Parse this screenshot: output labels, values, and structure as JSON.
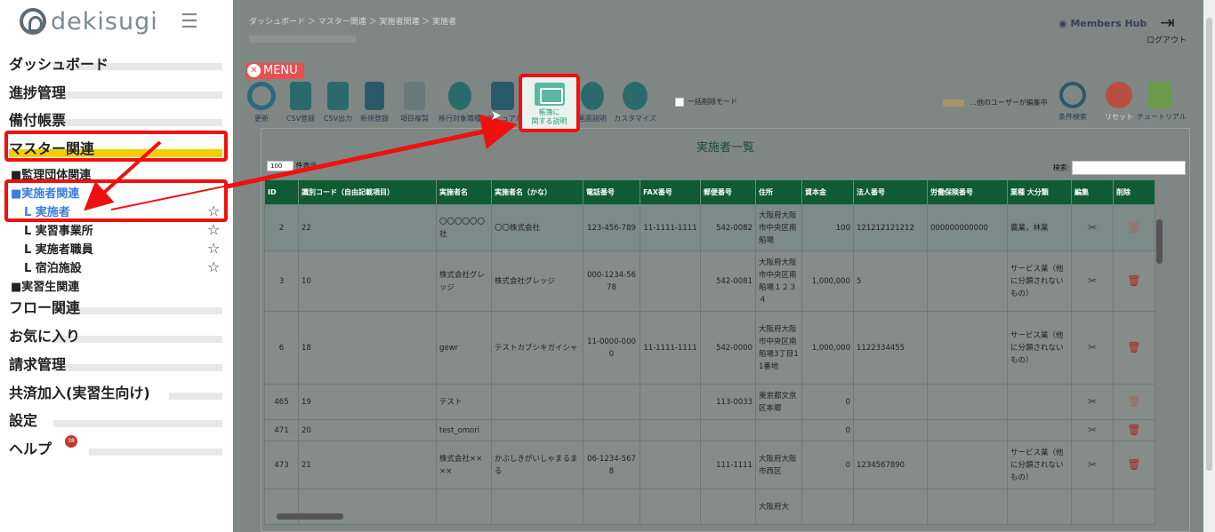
{
  "brand": {
    "name": "dekisugi"
  },
  "sidebar": {
    "sections": [
      {
        "label": "ダッシュボード"
      },
      {
        "label": "進捗管理"
      },
      {
        "label": "備付帳票"
      },
      {
        "label": "マスター関連"
      },
      {
        "label": "フロー関連"
      },
      {
        "label": "お気に入り"
      },
      {
        "label": "請求管理"
      },
      {
        "label": "共済加入(実習生向け)"
      },
      {
        "label": "設定"
      },
      {
        "label": "ヘルプ"
      }
    ],
    "subs": [
      {
        "label": "■監理団体関連"
      },
      {
        "label": "■実施者関連"
      },
      {
        "label": "■実習生関連"
      }
    ],
    "leaves": [
      {
        "label": "L 実施者"
      },
      {
        "label": "L 実習事業所"
      },
      {
        "label": "L 実施者職員"
      },
      {
        "label": "L 宿泊施設"
      }
    ],
    "help_badge": "38"
  },
  "header": {
    "breadcrumb": "ダッシュボード ＞ マスター関連 ＞ 実施者関連 ＞ 実施者",
    "members_hub": "Members Hub",
    "logout": "ログアウト"
  },
  "toolbar": {
    "menu": "MENU",
    "tools": [
      {
        "label": "更新",
        "icon": "refresh-icon"
      },
      {
        "label": "CSV登録",
        "icon": "csv-import-icon"
      },
      {
        "label": "CSV出力",
        "icon": "csv-export-icon"
      },
      {
        "label": "新規登録",
        "icon": "new-record-icon"
      },
      {
        "label": "項目複製",
        "icon": "duplicate-icon"
      },
      {
        "label": "移行対象職種",
        "icon": "transfer-icon"
      },
      {
        "label": "マニュアル",
        "icon": "manual-icon"
      },
      {
        "label": "画面説明",
        "icon": "screen-help-icon"
      },
      {
        "label": "カスタマイズ",
        "icon": "gear-icon"
      }
    ],
    "bulk_delete": "一括削除モード",
    "editing_notice": "…他のユーザーが編集中",
    "search_cond": "条件検索",
    "reset": "リセット",
    "tutorial": "チュートリアル",
    "popup_label_1": "帳簿に",
    "popup_label_2": "関する説明"
  },
  "panel": {
    "title": "実施者一覧",
    "length_value": "100",
    "length_label": "件表示",
    "search_label": "検索:",
    "columns": [
      "ID",
      "識別コード（自由記載項目）",
      "実施者名",
      "実施者名（かな）",
      "電話番号",
      "FAX番号",
      "郵便番号",
      "住所",
      "資本金",
      "法人番号",
      "労働保険番号",
      "業種 大分類",
      "編集",
      "削除"
    ],
    "rows": [
      [
        "2",
        "22",
        "〇〇〇〇〇〇社",
        "〇〇株式会社",
        "123-456-789",
        "11-1111-1111",
        "542-0082",
        "大阪府大阪市中央区南船場",
        "100",
        "121212121212",
        "000000000000",
        "農業，林業"
      ],
      [
        "3",
        "10",
        "株式会社グレッジ",
        "株式会社グレッジ",
        "000-1234-5678",
        "",
        "542-0081",
        "大阪府大阪市中央区南船場１２３４",
        "1,000,000",
        "5",
        "",
        "サービス業（他に分類されないもの）"
      ],
      [
        "6",
        "18",
        "gewr",
        "テストカブシキガイシャ",
        "11-0000-0000",
        "11-1111-1111",
        "542-0000",
        "大阪府大阪市中央区南船場3丁目11番地",
        "1,000,000",
        "1122334455",
        "",
        "サービス業（他に分類されないもの）"
      ],
      [
        "465",
        "19",
        "テスト",
        "",
        "",
        "",
        "113-0033",
        "東京都文京区本郷",
        "0",
        "",
        "",
        ""
      ],
      [
        "471",
        "20",
        "test_omori",
        "",
        "",
        "",
        "",
        "",
        "0",
        "",
        "",
        ""
      ],
      [
        "473",
        "21",
        "株式会社××××",
        "かぶしきがいしゃまるまる",
        "06-1234-5678",
        "",
        "111-1111",
        "大阪府大阪市西区",
        "0",
        "1234567890",
        "",
        "サービス業（他に分類されないもの）"
      ],
      [
        "",
        "",
        "",
        "",
        "",
        "",
        "",
        "大阪府大",
        "",
        "",
        "",
        ""
      ]
    ]
  },
  "colors": {
    "accent": "#0e5b34",
    "highlight": "#f01010",
    "menu": "#e85050"
  }
}
